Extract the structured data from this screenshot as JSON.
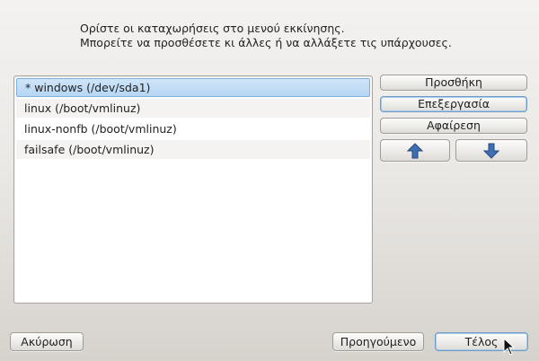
{
  "intro": {
    "line1": "Ορίστε οι καταχωρήσεις στο μενού εκκίνησης.",
    "line2": "Μπορείτε να προσθέσετε κι άλλες ή να αλλάξετε τις υπάρχουσες."
  },
  "entries": [
    {
      "label": "*  windows (/dev/sda1)",
      "selected": true
    },
    {
      "label": "linux (/boot/vmlinuz)",
      "selected": false
    },
    {
      "label": "linux-nonfb (/boot/vmlinuz)",
      "selected": false
    },
    {
      "label": "failsafe (/boot/vmlinuz)",
      "selected": false
    }
  ],
  "side_buttons": {
    "add": "Προσθήκη",
    "edit": "Επεξεργασία",
    "remove": "Αφαίρεση",
    "move_up_icon": "arrow-up-icon",
    "move_down_icon": "arrow-down-icon"
  },
  "footer": {
    "cancel": "Ακύρωση",
    "previous": "Προηγούμενο",
    "finish": "Τέλος"
  },
  "colors": {
    "arrow_fill": "#3f6fb2",
    "selection": "#b7d6f3"
  }
}
